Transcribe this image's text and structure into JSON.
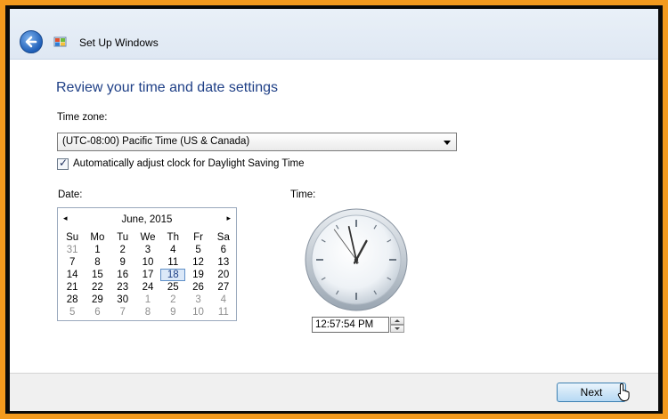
{
  "window": {
    "title": "Set Up Windows"
  },
  "page": {
    "heading": "Review your time and date settings"
  },
  "timezone": {
    "label": "Time zone:",
    "selected": "(UTC-08:00) Pacific Time (US & Canada)"
  },
  "dst": {
    "checked": true,
    "label": "Automatically adjust clock for Daylight Saving Time"
  },
  "date": {
    "label": "Date:",
    "month_title": "June, 2015",
    "prev_symbol": "◂",
    "next_symbol": "▸",
    "weekdays": [
      "Su",
      "Mo",
      "Tu",
      "We",
      "Th",
      "Fr",
      "Sa"
    ],
    "weeks": [
      [
        "31",
        "1",
        "2",
        "3",
        "4",
        "5",
        "6"
      ],
      [
        "7",
        "8",
        "9",
        "10",
        "11",
        "12",
        "13"
      ],
      [
        "14",
        "15",
        "16",
        "17",
        "18",
        "19",
        "20"
      ],
      [
        "21",
        "22",
        "23",
        "24",
        "25",
        "26",
        "27"
      ],
      [
        "28",
        "29",
        "30",
        "1",
        "2",
        "3",
        "4"
      ],
      [
        "5",
        "6",
        "7",
        "8",
        "9",
        "10",
        "11"
      ]
    ],
    "selected_day": "18"
  },
  "time": {
    "label": "Time:",
    "value": "12:57:54 PM",
    "clock": {
      "hour": 12,
      "minute": 57,
      "second": 54
    }
  },
  "footer": {
    "next_label": "Next"
  },
  "icons": {
    "back": "back-arrow-icon",
    "window": "windows-setup-icon",
    "cursor": "hand-pointer-icon"
  },
  "colors": {
    "heading": "#1e3f86",
    "background_frame": "#f39a1e",
    "accent": "#3c7fb1"
  }
}
